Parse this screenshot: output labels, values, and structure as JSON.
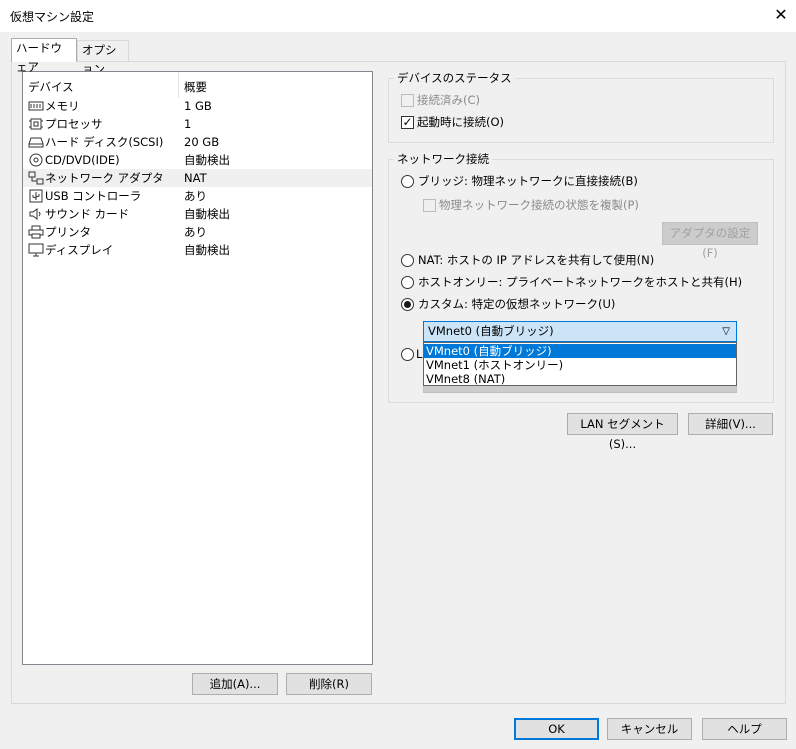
{
  "window": {
    "title": "仮想マシン設定",
    "close_glyph": "✕"
  },
  "tabs": [
    {
      "label": "ハードウェア",
      "active": true
    },
    {
      "label": "オプション",
      "active": false
    }
  ],
  "device_list": {
    "columns": [
      "デバイス",
      "概要"
    ],
    "rows": [
      {
        "icon": "memory-icon",
        "name": "メモリ",
        "value": "1 GB"
      },
      {
        "icon": "processor-icon",
        "name": "プロセッサ",
        "value": "1"
      },
      {
        "icon": "hard-disk-icon",
        "name": "ハード ディスク(SCSI)",
        "value": "20 GB"
      },
      {
        "icon": "cd-dvd-icon",
        "name": "CD/DVD(IDE)",
        "value": "自動検出"
      },
      {
        "icon": "network-adapter-icon",
        "name": "ネットワーク アダプタ",
        "value": "NAT",
        "selected": true
      },
      {
        "icon": "usb-icon",
        "name": "USB コントローラ",
        "value": "あり"
      },
      {
        "icon": "sound-card-icon",
        "name": "サウンド カード",
        "value": "自動検出"
      },
      {
        "icon": "printer-icon",
        "name": "プリンタ",
        "value": "あり"
      },
      {
        "icon": "display-icon",
        "name": "ディスプレイ",
        "value": "自動検出"
      }
    ],
    "add_button": "追加(A)...",
    "remove_button": "削除(R)"
  },
  "device_status": {
    "legend": "デバイスのステータス",
    "connected": {
      "label": "接続済み(C)",
      "checked": false,
      "enabled": false
    },
    "connect_at_power_on": {
      "label": "起動時に接続(O)",
      "checked": true,
      "enabled": true
    }
  },
  "network_connection": {
    "legend": "ネットワーク接続",
    "bridged": {
      "label": "ブリッジ: 物理ネットワークに直接接続(B)",
      "selected": false
    },
    "replicate": {
      "label": "物理ネットワーク接続の状態を複製(P)",
      "checked": false,
      "enabled": false
    },
    "configure_adapters_button": "アダプタの設定(F)",
    "nat": {
      "label": "NAT: ホストの IP アドレスを共有して使用(N)",
      "selected": false
    },
    "host_only": {
      "label": "ホストオンリー: プライベートネットワークをホストと共有(H)",
      "selected": false
    },
    "custom": {
      "label": "カスタム: 特定の仮想ネットワーク(U)",
      "selected": true
    },
    "lan_segment_partial": "L",
    "combo": {
      "selected": "VMnet0 (自動ブリッジ)",
      "options": [
        "VMnet0 (自動ブリッジ)",
        "VMnet1 (ホストオンリー)",
        "VMnet8 (NAT)"
      ]
    },
    "lan_segments_button": "LAN セグメント(S)...",
    "advanced_button": "詳細(V)..."
  },
  "footer": {
    "ok": "OK",
    "cancel": "キャンセル",
    "help": "ヘルプ"
  },
  "colors": {
    "accent": "#0078d7",
    "combo_bg": "#cce4f7",
    "selection_bg": "#0078d7"
  }
}
